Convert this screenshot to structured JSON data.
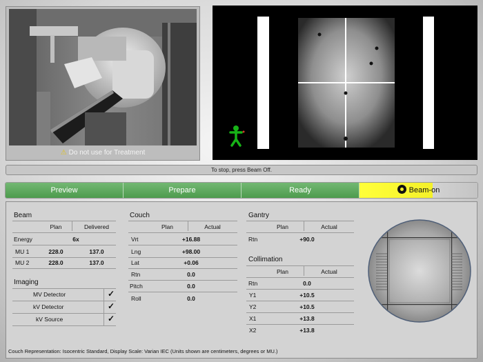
{
  "camera": {
    "warning": "Do not use for Treatment"
  },
  "status": {
    "message": "To stop, press Beam Off."
  },
  "workflow": {
    "steps": [
      "Preview",
      "Prepare",
      "Ready",
      "Beam-on"
    ],
    "active": "Beam-on",
    "colors": {
      "done": "#5aab5a",
      "active": "#f4f12a"
    }
  },
  "beam": {
    "title": "Beam",
    "headers": [
      "Plan",
      "Delivered"
    ],
    "energy": {
      "label": "Energy",
      "value": "6x"
    },
    "rows": [
      {
        "label": "MU 1",
        "plan": "228.0",
        "delivered": "137.0"
      },
      {
        "label": "MU 2",
        "plan": "228.0",
        "delivered": "137.0"
      }
    ]
  },
  "imaging": {
    "title": "Imaging",
    "items": [
      {
        "label": "MV Detector",
        "check": "✓"
      },
      {
        "label": "kV Detector",
        "check": "✓"
      },
      {
        "label": "kV Source",
        "check": "✓"
      }
    ]
  },
  "couch": {
    "title": "Couch",
    "headers": [
      "Plan",
      "Actual"
    ],
    "rows": [
      {
        "label": "Vrt",
        "value": "+16.88"
      },
      {
        "label": "Lng",
        "value": "+98.00"
      },
      {
        "label": "Lat",
        "value": "+0.06"
      },
      {
        "label": "Rtn",
        "value": "0.0"
      },
      {
        "label": "Pitch",
        "value": "0.0"
      },
      {
        "label": "Roll",
        "value": "0.0"
      }
    ]
  },
  "gantry": {
    "title": "Gantry",
    "headers": [
      "Plan",
      "Actual"
    ],
    "rows": [
      {
        "label": "Rtn",
        "value": "+90.0"
      }
    ]
  },
  "collimation": {
    "title": "Collimation",
    "headers": [
      "Plan",
      "Actual"
    ],
    "rows": [
      {
        "label": "Rtn",
        "value": "0.0"
      },
      {
        "label": "Y1",
        "value": "+10.5"
      },
      {
        "label": "Y2",
        "value": "+10.5"
      },
      {
        "label": "X1",
        "value": "+13.8"
      },
      {
        "label": "X2",
        "value": "+13.8"
      }
    ]
  },
  "footer": {
    "note": "Couch Representation: Isocentric Standard, Display Scale: Varian IEC (Units shown are centimeters, degrees or MU.)"
  }
}
